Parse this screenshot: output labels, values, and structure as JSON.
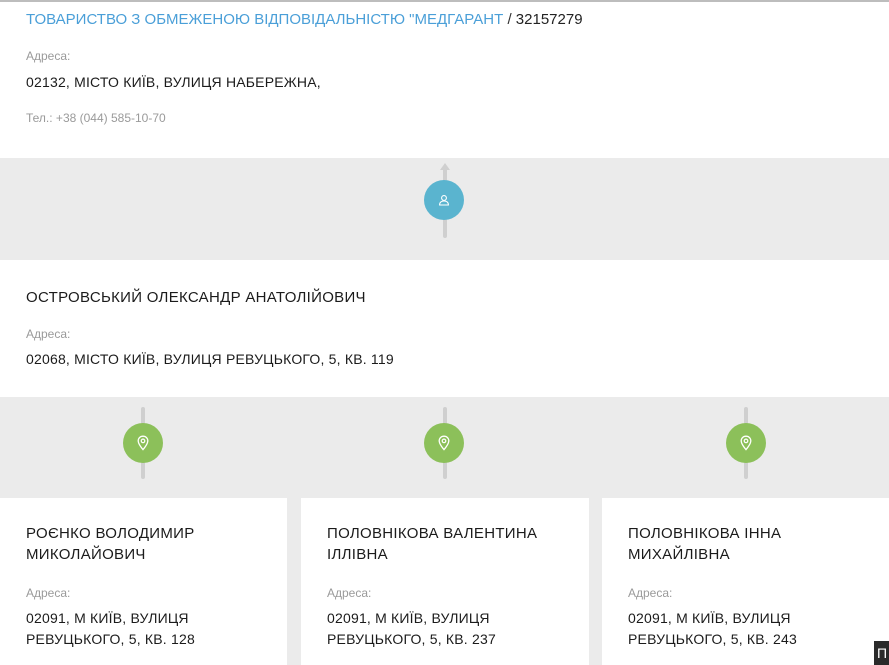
{
  "company": {
    "name": "ТОВАРИСТВО З ОБМЕЖЕНОЮ ВІДПОВІДАЛЬНІСТЮ \"МЕДГАРАНТ",
    "separator": "/",
    "code": "32157279",
    "address_label": "Адреса:",
    "address": "02132, МІСТО КИЇВ, ВУЛИЦЯ НАБЕРЕЖНА,",
    "phone": "Тел.: +38 (044) 585-10-70"
  },
  "colors": {
    "link": "#4a9fd8",
    "person_icon_bg": "#5ab4cf",
    "pin_icon_bg": "#8cc05a"
  },
  "icons": {
    "person": "person-icon",
    "pin": "map-pin-icon"
  },
  "director": {
    "name": "ОСТРОВСЬКИЙ ОЛЕКСАНДР АНАТОЛІЙОВИЧ",
    "address_label": "Адреса:",
    "address": "02068, МІСТО КИЇВ, ВУЛИЦЯ РЕВУЦЬКОГО, 5, КВ. 119"
  },
  "founders": [
    {
      "name": "РОЄНКО ВОЛОДИМИР МИКОЛАЙОВИЧ",
      "address_label": "Адреса:",
      "address": "02091, М КИЇВ, ВУЛИЦЯ РЕВУЦЬКОГО, 5, КВ. 128"
    },
    {
      "name": "ПОЛОВНІКОВА ВАЛЕНТИНА ІЛЛІВНА",
      "address_label": "Адреса:",
      "address": "02091, М КИЇВ, ВУЛИЦЯ РЕВУЦЬКОГО, 5, КВ. 237"
    },
    {
      "name": "ПОЛОВНІКОВА ІННА МИХАЙЛІВНА",
      "address_label": "Адреса:",
      "address": "02091, М КИЇВ, ВУЛИЦЯ РЕВУЦЬКОГО, 5, КВ. 243"
    }
  ],
  "corner_button": {
    "label": "П"
  }
}
